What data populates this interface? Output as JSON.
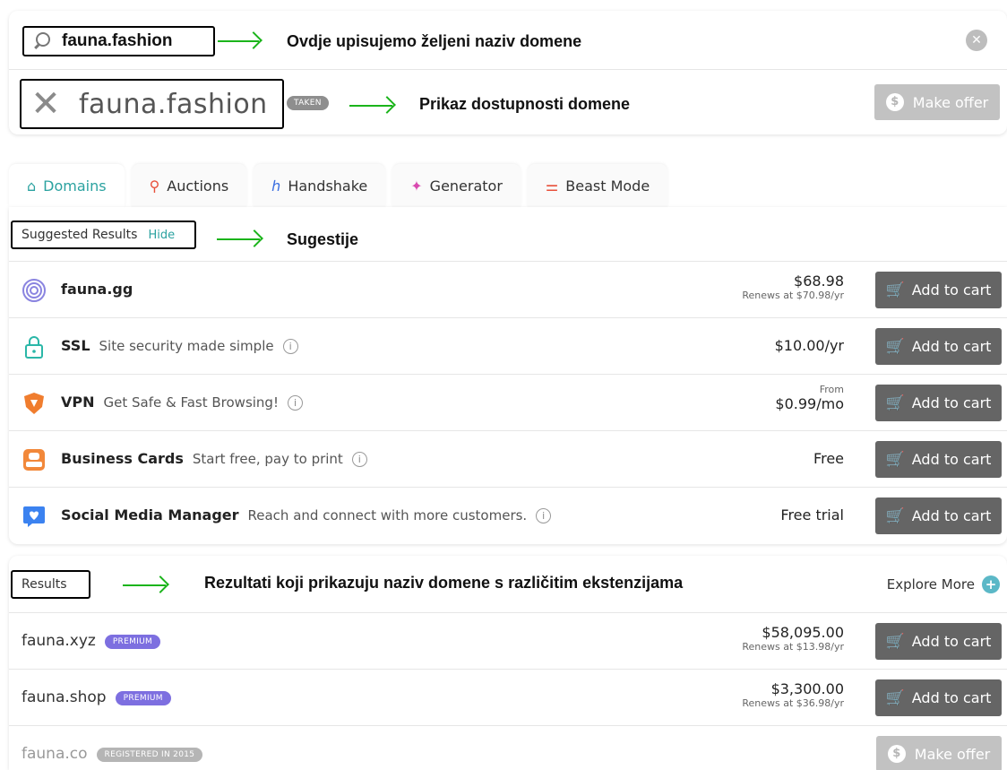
{
  "search": {
    "query": "fauna.fashion",
    "annotation": "Ovdje upisujemo željeni naziv domene",
    "clear_icon": "x-circle-icon"
  },
  "availability": {
    "domain": "fauna.fashion",
    "status_badge": "TAKEN",
    "annotation": "Prikaz dostupnosti domene",
    "action_label": "Make offer"
  },
  "tabs": [
    {
      "label": "Domains",
      "icon": "home-icon",
      "active": true
    },
    {
      "label": "Auctions",
      "icon": "auction-icon",
      "active": false
    },
    {
      "label": "Handshake",
      "icon": "handshake-icon",
      "active": false
    },
    {
      "label": "Generator",
      "icon": "generator-icon",
      "active": false
    },
    {
      "label": "Beast Mode",
      "icon": "sliders-icon",
      "active": false
    }
  ],
  "suggested": {
    "title": "Suggested Results",
    "hide_label": "Hide",
    "annotation": "Sugestije",
    "items": [
      {
        "name": "fauna.gg",
        "desc": "",
        "price": "$68.98",
        "sub": "Renews at $70.98/yr",
        "action": "Add to cart"
      },
      {
        "name": "SSL",
        "desc": "Site security made simple",
        "price": "$10.00/yr",
        "sub": "",
        "action": "Add to cart"
      },
      {
        "name": "VPN",
        "desc": "Get Safe & Fast Browsing!",
        "price_prefix": "From",
        "price": "$0.99/mo",
        "action": "Add to cart"
      },
      {
        "name": "Business Cards",
        "desc": "Start free, pay to print",
        "price": "Free",
        "action": "Add to cart"
      },
      {
        "name": "Social Media Manager",
        "desc": "Reach and connect with more customers.",
        "price": "Free trial",
        "action": "Add to cart"
      }
    ]
  },
  "results": {
    "title": "Results",
    "annotation": "Rezultati koji prikazuju naziv domene s različitim ekstenzijama",
    "explore_label": "Explore More",
    "items": [
      {
        "name": "fauna.xyz",
        "badge": "PREMIUM",
        "price": "$58,095.00",
        "sub": "Renews at $13.98/yr",
        "action": "Add to cart"
      },
      {
        "name": "fauna.shop",
        "badge": "PREMIUM",
        "price": "$3,300.00",
        "sub": "Renews at $36.98/yr",
        "action": "Add to cart"
      },
      {
        "name": "fauna.co",
        "badge": "REGISTERED IN 2015",
        "action": "Make offer"
      }
    ]
  },
  "colors": {
    "teal": "#2ba2a0",
    "button": "#656565",
    "premium": "#7d6fe0",
    "arrow": "#1bb41b"
  }
}
